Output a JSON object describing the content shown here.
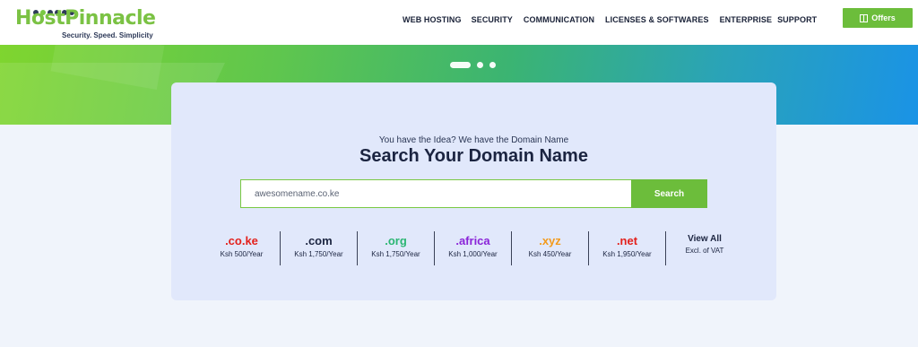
{
  "brand": {
    "logo_name_part1": "HostPinnacle",
    "tagline": "Security. Speed. Simplicity"
  },
  "nav": {
    "items": [
      {
        "label": "WEB HOSTING",
        "gap_after": 11
      },
      {
        "label": "SECURITY",
        "gap_after": 12
      },
      {
        "label": "COMMUNICATION",
        "gap_after": 12
      },
      {
        "label": "LICENSES & SOFTWARES",
        "gap_after": 12
      },
      {
        "label": "ENTERPRISE",
        "gap_after": 6
      },
      {
        "label": "SUPPORT",
        "gap_after": 0
      }
    ],
    "offers_label": "Offers"
  },
  "colors": {
    "accent_green": "#6cbd3b",
    "heading_dark": "#1b2440",
    "co_ke": "#e3211c",
    "com": "#1b2440",
    "org": "#2bb673",
    "africa": "#8a24d8",
    "xyz": "#f39a1b",
    "net": "#e3211c"
  },
  "hero": {
    "slides": [
      {
        "active": true
      },
      {
        "active": false
      },
      {
        "active": false
      }
    ]
  },
  "search": {
    "subtitle": "You have the Idea? We have the Domain Name",
    "title": "Search Your Domain Name",
    "input_value": "awesomename.co.ke",
    "button_label": "Search"
  },
  "tlds": [
    {
      "name": ".co.ke",
      "price": "Ksh 500/Year",
      "color": "#e3211c"
    },
    {
      "name": ".com",
      "price": "Ksh 1,750/Year",
      "color": "#1b2440"
    },
    {
      "name": ".org",
      "price": "Ksh 1,750/Year",
      "color": "#2bb673"
    },
    {
      "name": ".africa",
      "price": "Ksh 1,000/Year",
      "color": "#8a24d8"
    },
    {
      "name": ".xyz",
      "price": "Ksh 450/Year",
      "color": "#f39a1b"
    },
    {
      "name": ".net",
      "price": "Ksh 1,950/Year",
      "color": "#e3211c"
    }
  ],
  "view_all": {
    "label": "View All",
    "note": "Excl. of VAT"
  }
}
